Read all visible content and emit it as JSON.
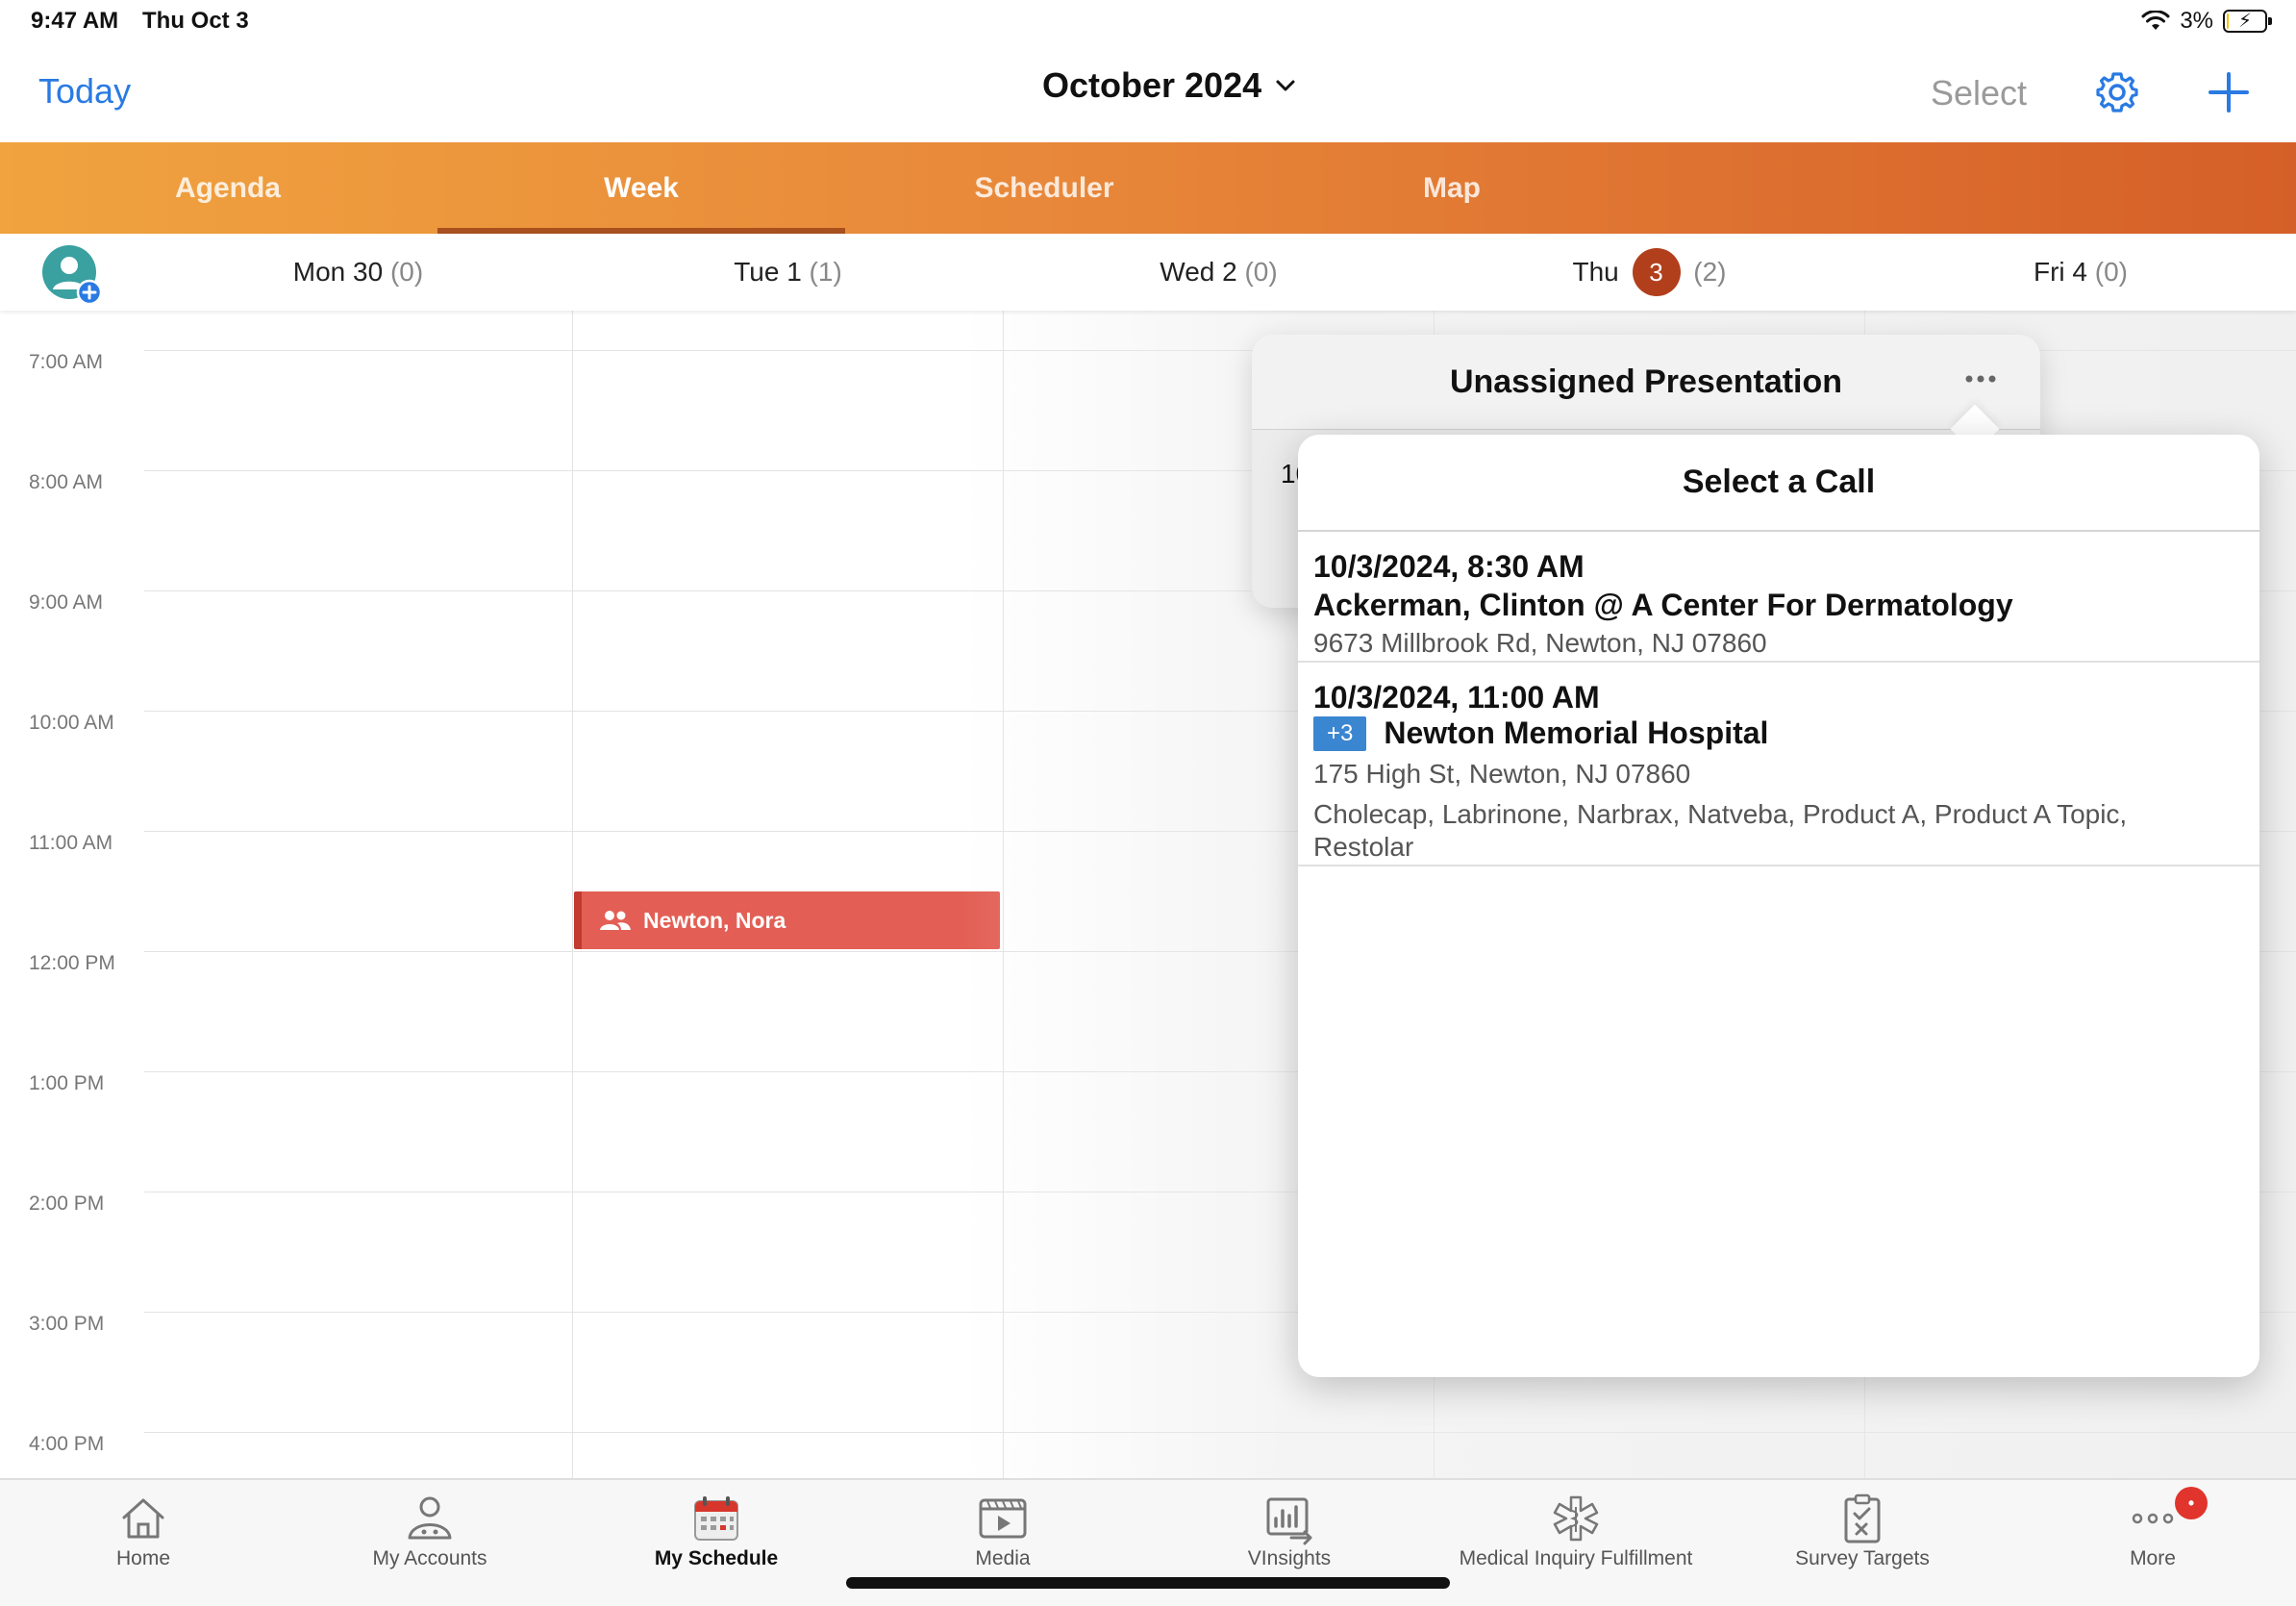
{
  "status_bar": {
    "time": "9:47 AM",
    "date": "Thu Oct 3",
    "battery": "3%",
    "battery_level": 0.03
  },
  "nav": {
    "today": "Today",
    "month": "October 2024",
    "select": "Select"
  },
  "tabs": [
    {
      "label": "Agenda"
    },
    {
      "label": "Week"
    },
    {
      "label": "Scheduler"
    },
    {
      "label": "Map"
    }
  ],
  "active_tab": "Week",
  "week_days": [
    {
      "label": "Mon 30",
      "count": "(0)"
    },
    {
      "label": "Tue 1",
      "count": "(1)"
    },
    {
      "label": "Wed 2",
      "count": "(0)"
    },
    {
      "label": "Thu",
      "badge": "3",
      "count": "(2)"
    },
    {
      "label": "Fri 4",
      "count": "(0)"
    }
  ],
  "hours": [
    "7:00 AM",
    "8:00 AM",
    "9:00 AM",
    "10:00 AM",
    "11:00 AM",
    "12:00 PM",
    "1:00 PM",
    "2:00 PM",
    "3:00 PM",
    "4:00 PM"
  ],
  "event": {
    "title": "Newton, Nora"
  },
  "unassigned_popover": {
    "title": "Unassigned Presentation",
    "clipped_text": "10"
  },
  "select_call": {
    "title": "Select a Call",
    "calls": [
      {
        "datetime": "10/3/2024, 8:30 AM",
        "name": "Ackerman, Clinton @ A Center For Dermatology",
        "address": "9673 Millbrook Rd, Newton, NJ 07860"
      },
      {
        "datetime": "10/3/2024, 11:00 AM",
        "badge": "+3",
        "name": "Newton Memorial Hospital",
        "address": "175 High St, Newton, NJ 07860",
        "products": "Cholecap, Labrinone, Narbrax, Natveba, Product A, Product A Topic, Restolar"
      }
    ]
  },
  "bottom_tabs": [
    {
      "label": "Home",
      "icon": "home-icon"
    },
    {
      "label": "My Accounts",
      "icon": "accounts-icon"
    },
    {
      "label": "My Schedule",
      "icon": "calendar-icon"
    },
    {
      "label": "Media",
      "icon": "media-icon"
    },
    {
      "label": "VInsights",
      "icon": "insights-icon"
    },
    {
      "label": "Medical Inquiry Fulfillment",
      "icon": "medical-icon"
    },
    {
      "label": "Survey Targets",
      "icon": "survey-icon"
    },
    {
      "label": "More",
      "icon": "more-icon"
    }
  ],
  "active_bottom_tab": "My Schedule",
  "colors": {
    "accent_blue": "#2a7ae2",
    "event_red": "#e35f55",
    "today_badge": "#b23f1c",
    "tab_gradient_start": "#f0a33f",
    "tab_gradient_end": "#d55f28"
  }
}
